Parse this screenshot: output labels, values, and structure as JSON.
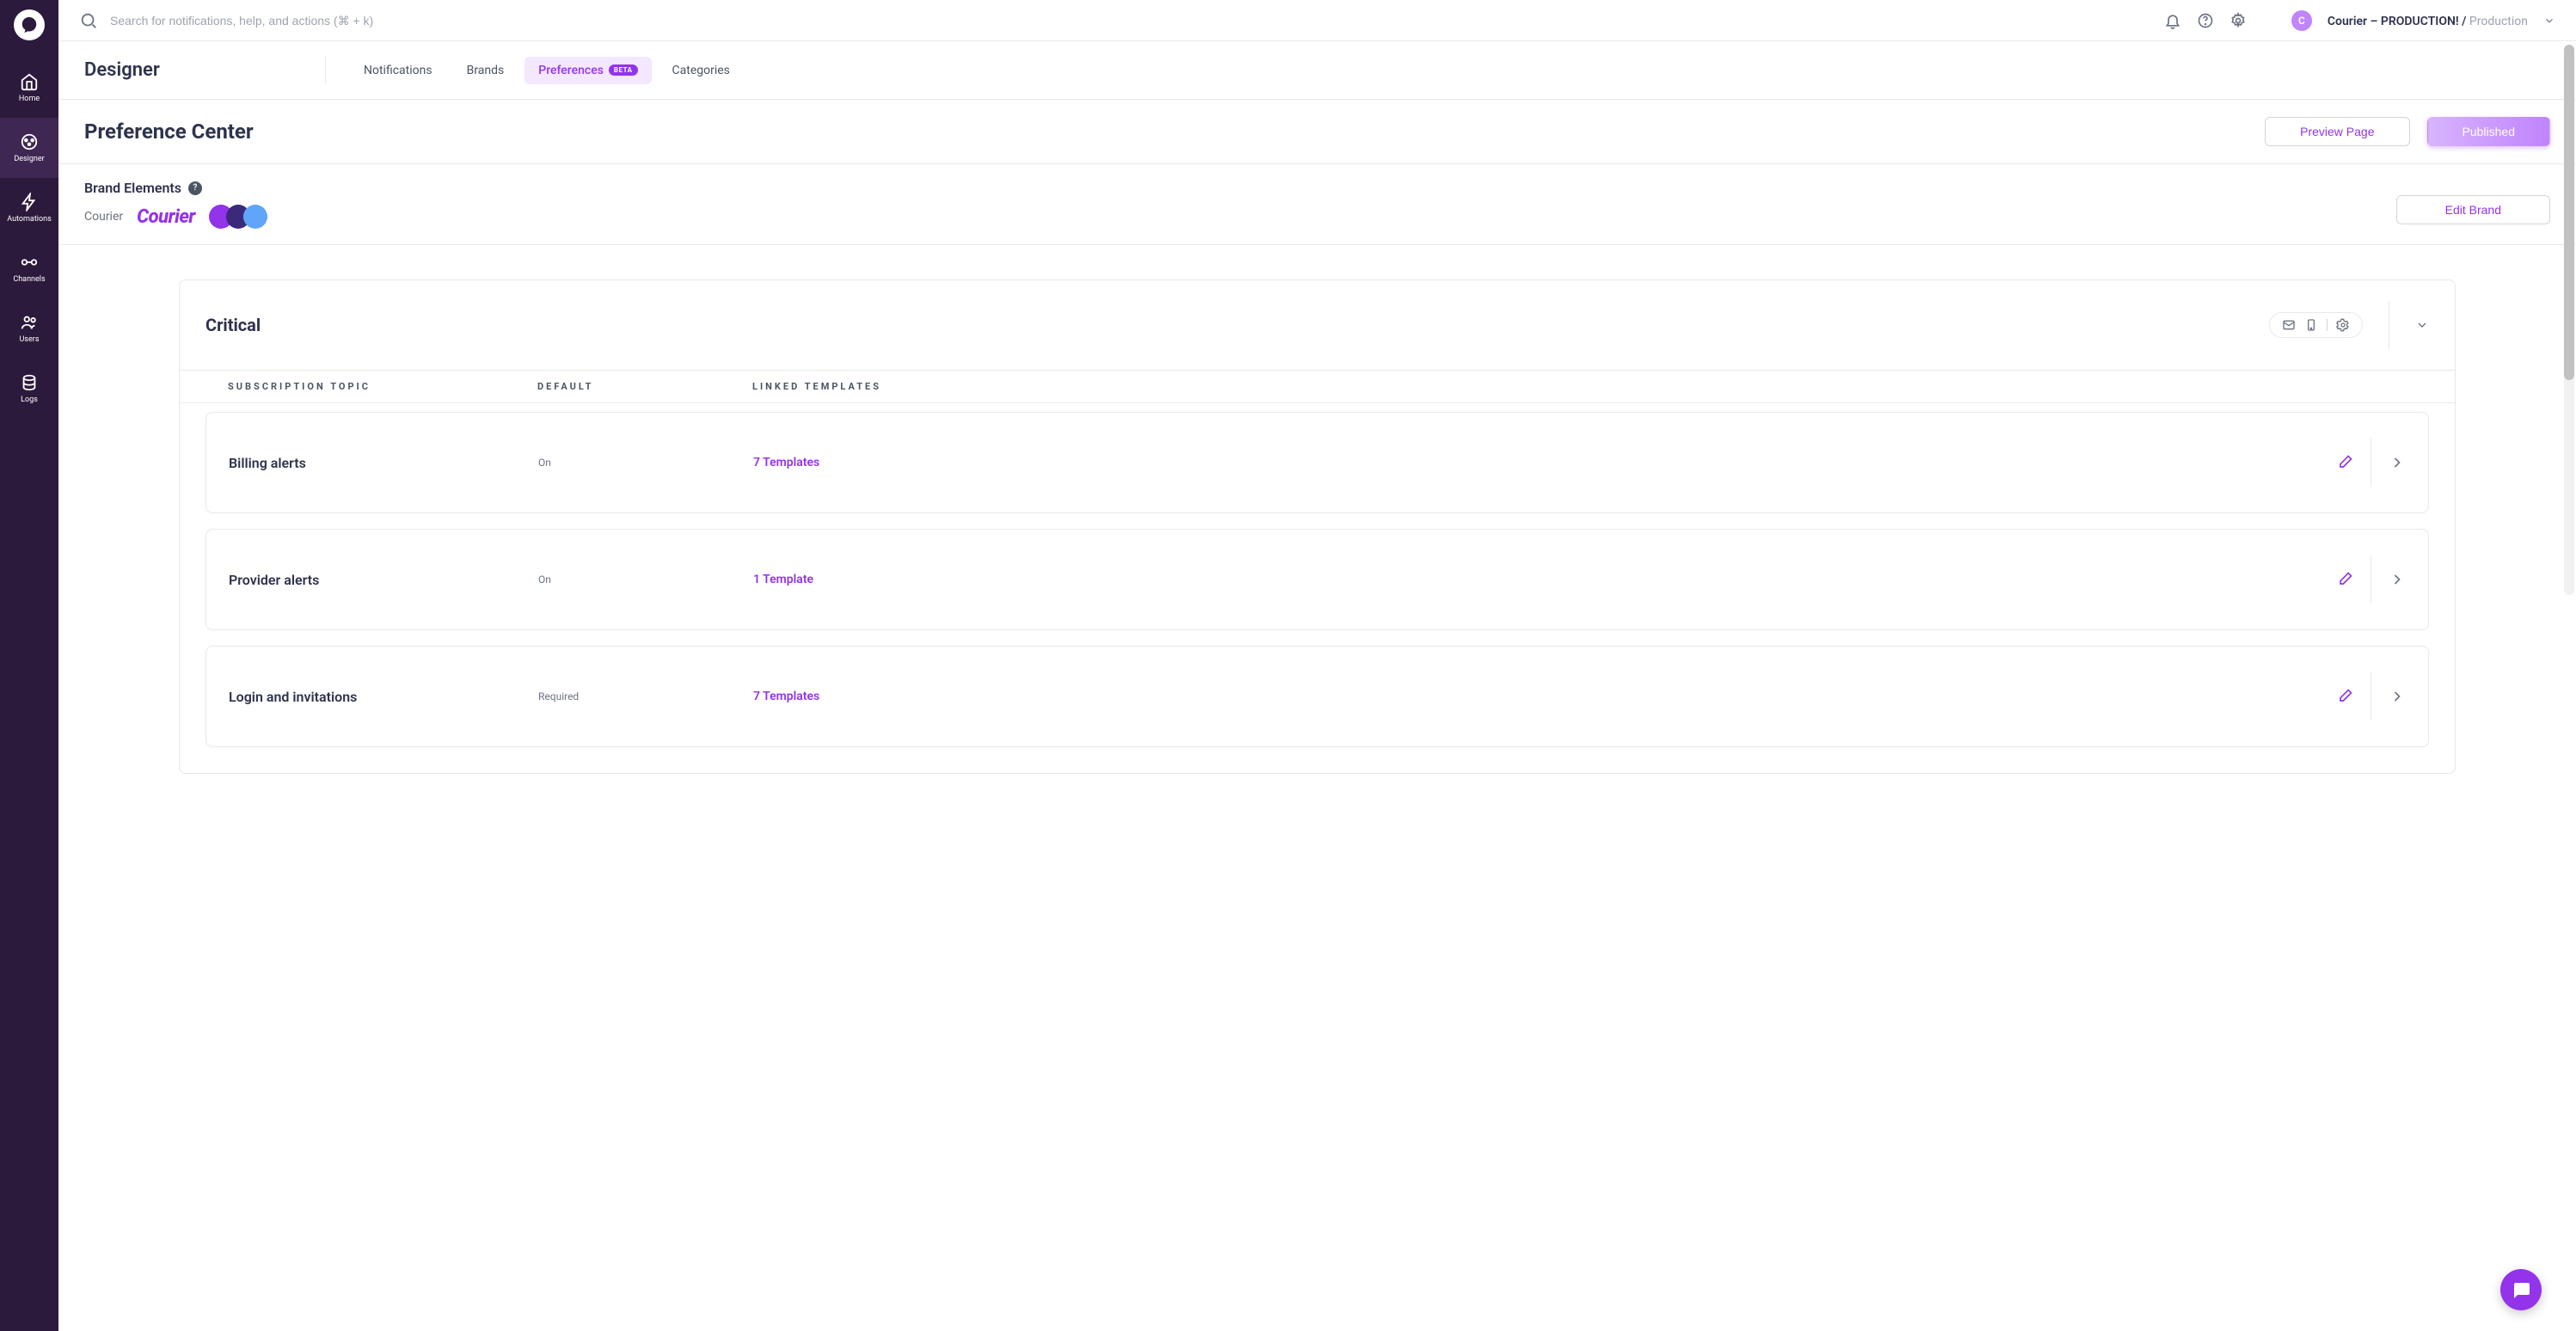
{
  "search": {
    "placeholder": "Search for notifications, help, and actions (⌘ + k)"
  },
  "workspace": {
    "avatar_letter": "C",
    "name": "Courier – PRODUCTION! /",
    "env": " Production"
  },
  "sidebar": {
    "items": [
      {
        "label": "Home"
      },
      {
        "label": "Designer"
      },
      {
        "label": "Automations"
      },
      {
        "label": "Channels"
      },
      {
        "label": "Users"
      },
      {
        "label": "Logs"
      }
    ]
  },
  "section": {
    "title": "Designer"
  },
  "tabs": {
    "notifications": "Notifications",
    "brands": "Brands",
    "preferences": "Preferences",
    "preferences_badge": "BETA",
    "categories": "Categories"
  },
  "page": {
    "title": "Preference Center",
    "preview": "Preview Page",
    "published": "Published"
  },
  "brand": {
    "heading": "Brand Elements",
    "help": "?",
    "name": "Courier",
    "logo_text": "Courier",
    "colors": [
      "#9333ea",
      "#3b2a7a",
      "#60a5fa"
    ],
    "edit": "Edit Brand"
  },
  "card": {
    "title": "Critical",
    "columns": {
      "topic": "SUBSCRIPTION TOPIC",
      "default": "DEFAULT",
      "linked": "LINKED TEMPLATES"
    },
    "rows": [
      {
        "name": "Billing alerts",
        "default": "On",
        "templates": "7 Templates"
      },
      {
        "name": "Provider alerts",
        "default": "On",
        "templates": "1 Template"
      },
      {
        "name": "Login and invitations",
        "default": "Required",
        "templates": "7 Templates"
      }
    ]
  }
}
